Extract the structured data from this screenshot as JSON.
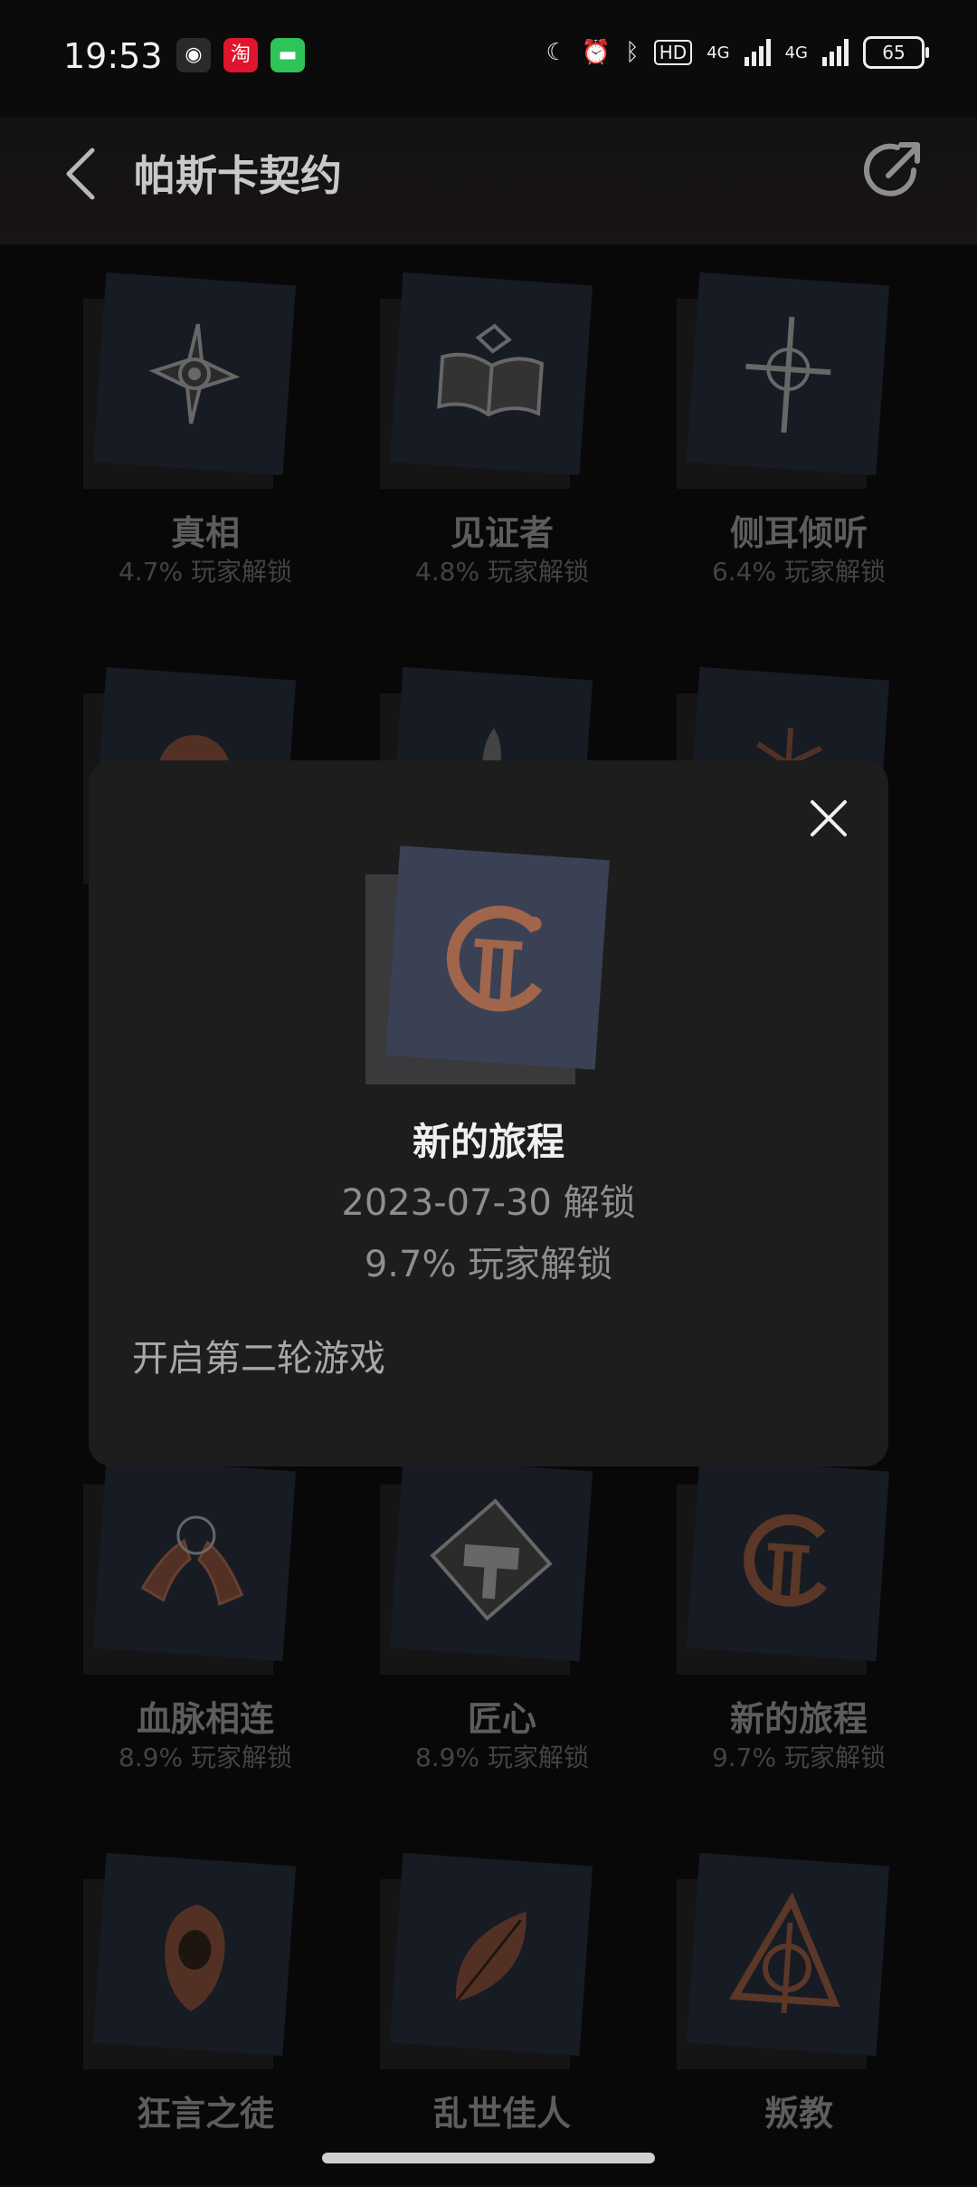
{
  "status_bar": {
    "time": "19:53",
    "apps": [
      {
        "icon": "wechat-icon",
        "glyph": "◉",
        "color": "#2a2a2a"
      },
      {
        "icon": "taobao-icon",
        "glyph": "淘",
        "color": "#e0142d"
      },
      {
        "icon": "messages-icon",
        "glyph": "▬",
        "color": "#2fc45a"
      }
    ],
    "hd_label": "HD",
    "network_1": "4G",
    "network_2": "4G",
    "battery": "65"
  },
  "header": {
    "title": "帕斯卡契约",
    "back_icon": "chevron-left-icon",
    "share_icon": "share-icon"
  },
  "achievements": [
    {
      "name": "真相",
      "percent": "4.7% 玩家解锁",
      "icon": "eye-star-icon"
    },
    {
      "name": "见证者",
      "percent": "4.8% 玩家解锁",
      "icon": "open-book-icon"
    },
    {
      "name": "侧耳倾听",
      "percent": "6.4% 玩家解锁",
      "icon": "cross-sword-icon"
    },
    {
      "name": "血脉相连",
      "percent": "8.9% 玩家解锁",
      "icon": "twin-hands-icon"
    },
    {
      "name": "匠心",
      "percent": "8.9% 玩家解锁",
      "icon": "hammer-diamond-icon"
    },
    {
      "name": "新的旅程",
      "percent": "9.7% 玩家解锁",
      "icon": "journey-ring-icon"
    },
    {
      "name": "狂言之徒",
      "percent": "",
      "icon": "hooded-figure-icon"
    },
    {
      "name": "乱世佳人",
      "percent": "",
      "icon": "leaf-icon"
    },
    {
      "name": "叛教",
      "percent": "",
      "icon": "triangle-sigil-icon"
    }
  ],
  "modal": {
    "name": "新的旅程",
    "date": "2023-07-30 解锁",
    "percent": "9.7% 玩家解锁",
    "description": "开启第二轮游戏",
    "icon": "journey-ring-icon",
    "close_icon": "close-icon"
  },
  "colors": {
    "background": "#0b0b0c",
    "modal_bg": "#1d1d1e",
    "icon_copper": "#a0654b",
    "card_bg": "#1f2430"
  }
}
